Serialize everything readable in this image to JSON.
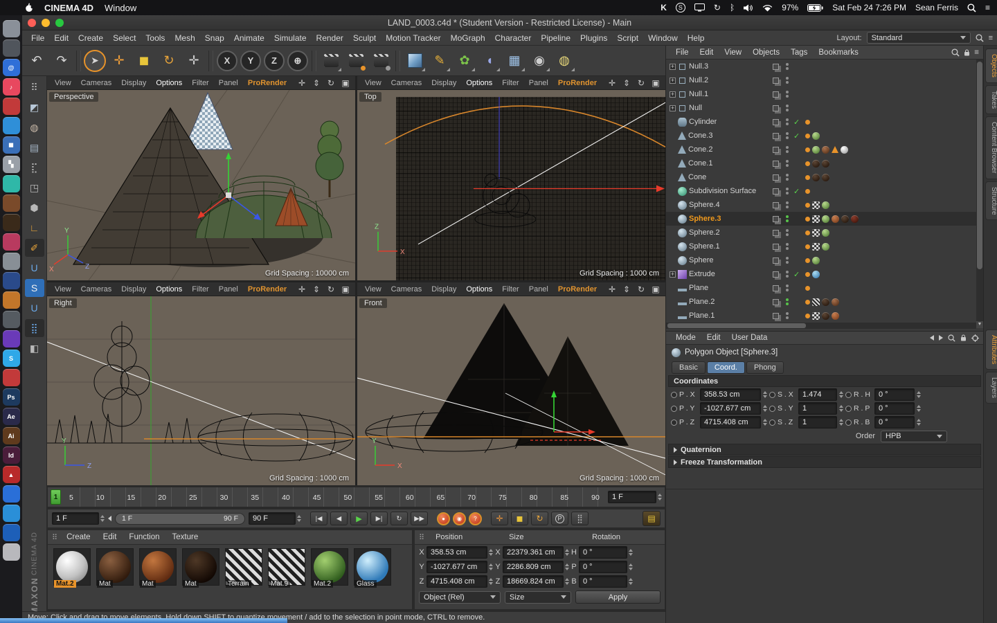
{
  "colors": {
    "accent": "#f09a1f",
    "selection_blue": "#5b7fa6",
    "viewport_bg": "#6b6257",
    "prorender_orange": "#e0932f"
  },
  "macos": {
    "app_name": "CINEMA 4D",
    "menus": [
      "Window"
    ],
    "status": {
      "battery": "97%",
      "datetime": "Sat Feb 24 7:26 PM",
      "user": "Sean Ferris"
    },
    "status_icon_names": [
      "keyboard-maestro",
      "skype",
      "display",
      "sync",
      "bluetooth",
      "volume",
      "wifi",
      "battery-charging",
      "spotlight-search",
      "notification-center"
    ]
  },
  "window_title": "LAND_0003.c4d * (Student Version - Restricted License) - Main",
  "app_menu": {
    "items": [
      "File",
      "Edit",
      "Create",
      "Select",
      "Tools",
      "Mesh",
      "Snap",
      "Animate",
      "Simulate",
      "Render",
      "Sculpt",
      "Motion Tracker",
      "MoGraph",
      "Character",
      "Pipeline",
      "Plugins",
      "Script",
      "Window",
      "Help"
    ],
    "layout_label": "Layout:",
    "layout_value": "Standard"
  },
  "icons": {
    "panel_handle": "⠿",
    "hamburger": "≡"
  },
  "toolbar": {
    "buttons": [
      {
        "name": "undo-icon",
        "glyph": "↶"
      },
      {
        "name": "redo-icon",
        "glyph": "↷"
      },
      {
        "cls": "sep"
      },
      {
        "name": "live-selection-icon",
        "glyph": "➤",
        "cls": "active-tool"
      },
      {
        "name": "move-tool-icon",
        "glyph": "✛",
        "fg": "#e89a3a"
      },
      {
        "name": "scale-tool-icon",
        "glyph": "◼",
        "fg": "#e8c53a"
      },
      {
        "name": "rotate-tool-icon",
        "glyph": "↻",
        "fg": "#e8a43a"
      },
      {
        "name": "last-tool-icon",
        "glyph": "✛",
        "fg": "#c9c9c9"
      },
      {
        "cls": "sep"
      },
      {
        "name": "lock-x-icon",
        "glyph": "X",
        "cls": "axis"
      },
      {
        "name": "lock-y-icon",
        "glyph": "Y",
        "cls": "axis"
      },
      {
        "name": "lock-z-icon",
        "glyph": "Z",
        "cls": "axis"
      },
      {
        "name": "coord-system-icon",
        "glyph": "⊕",
        "cls": "axis"
      },
      {
        "cls": "sep"
      },
      {
        "name": "render-view-icon",
        "cls": "clapper dd"
      },
      {
        "name": "render-picture-viewer-icon",
        "cls": "clapper c2 dd"
      },
      {
        "name": "render-settings-icon",
        "cls": "clapper c3 dd"
      },
      {
        "cls": "sep"
      },
      {
        "name": "add-primitive-cube-icon",
        "cls": "bigcube dd"
      },
      {
        "name": "add-spline-pen-icon",
        "glyph": "✎",
        "fg": "#e8b13a",
        "cls": "dd"
      },
      {
        "name": "mograph-icon",
        "glyph": "✿",
        "fg": "#7cc24a",
        "cls": "dd"
      },
      {
        "name": "simulate-deformer-icon",
        "glyph": "◖",
        "fg": "#9aa8e8",
        "cls": "dd"
      },
      {
        "name": "environment-floor-icon",
        "glyph": "▦",
        "fg": "#9fc3e8",
        "cls": "dd"
      },
      {
        "name": "camera-icon",
        "glyph": "◉",
        "fg": "#cfcfcf",
        "cls": "dd"
      },
      {
        "name": "light-icon",
        "glyph": "◍",
        "fg": "#e8d87a",
        "cls": "dd"
      }
    ]
  },
  "palette": {
    "icons": [
      {
        "name": "make-editable-icon",
        "glyph": "⠿",
        "fg": "#b8b8b8"
      },
      {
        "name": "model-mode-icon",
        "glyph": "◩",
        "fg": "#b8c8d8"
      },
      {
        "name": "texture-mode-icon",
        "glyph": "◍",
        "fg": "#c8b8a8"
      },
      {
        "name": "workplane-icon",
        "glyph": "▤",
        "fg": "#a8b8c8"
      },
      {
        "name": "points-mode-icon",
        "glyph": "⣏",
        "fg": "#b8b8b8"
      },
      {
        "name": "edges-mode-icon",
        "glyph": "◳",
        "fg": "#b8b8b8"
      },
      {
        "name": "polygons-mode-icon",
        "glyph": "⬢",
        "fg": "#b8b8b8"
      },
      {
        "name": "axis-mode-icon",
        "glyph": "∟",
        "fg": "#e8a43a"
      },
      {
        "name": "snap-pen-icon",
        "glyph": "✐",
        "fg": "#e8a43a",
        "bg": "#2c2c2c"
      },
      {
        "name": "magnet-snap-icon",
        "glyph": "U",
        "fg": "#6aa8e8"
      },
      {
        "name": "sculpt-icon",
        "glyph": "S",
        "fg": "#f0f0f0",
        "bg": "#2f6fb8"
      },
      {
        "name": "magnet-icon",
        "glyph": "U",
        "fg": "#6aa8e8"
      },
      {
        "name": "array-icon",
        "glyph": "⣿",
        "fg": "#6aa8e8",
        "bg": "#2c2c2c"
      },
      {
        "name": "lock-workplane-icon",
        "glyph": "◧",
        "fg": "#b8b8b8"
      }
    ]
  },
  "dock": {
    "icons": [
      {
        "name": "dock-finder-icon",
        "color": "#8a9099"
      },
      {
        "name": "dock-settings-icon",
        "color": "#50555c"
      },
      {
        "name": "dock-browser-icon",
        "color": "#2f6fd8",
        "glyph": "@"
      },
      {
        "name": "dock-music-icon",
        "color": "#e8485f",
        "glyph": "♪"
      },
      {
        "name": "dock-app-red-icon",
        "color": "#c23a3a"
      },
      {
        "name": "dock-app-blue-icon",
        "color": "#2f8fd8"
      },
      {
        "name": "dock-cinema4d-icon",
        "color": "#3a6fb8",
        "glyph": "◼"
      },
      {
        "name": "dock-checker-icon",
        "color": "#9aa0a8",
        "glyph": "▚"
      },
      {
        "name": "dock-chat-icon",
        "color": "#2fb8a8"
      },
      {
        "name": "dock-sphere-brown-icon",
        "color": "#7a4a2a"
      },
      {
        "name": "dock-sphere-dark-icon",
        "color": "#3a2a1a"
      },
      {
        "name": "dock-flower-icon",
        "color": "#b83a5f"
      },
      {
        "name": "dock-app-gray-icon",
        "color": "#888f96"
      },
      {
        "name": "dock-app-navy-icon",
        "color": "#2a4a8a"
      },
      {
        "name": "dock-pen-icon",
        "color": "#c2762a"
      },
      {
        "name": "dock-gear-icon",
        "color": "#555b61"
      },
      {
        "name": "dock-app-purple-icon",
        "color": "#6a3ab8"
      },
      {
        "name": "dock-skype-icon",
        "color": "#2fa8e8",
        "glyph": "S"
      },
      {
        "name": "dock-app-red2-icon",
        "color": "#c23a3a"
      },
      {
        "name": "dock-photoshop-icon",
        "color": "#1d3a5f",
        "glyph": "Ps"
      },
      {
        "name": "dock-aftereffects-icon",
        "color": "#2a2a4a",
        "glyph": "Ae"
      },
      {
        "name": "dock-illustrator-icon",
        "color": "#5f3a1d",
        "glyph": "Ai"
      },
      {
        "name": "dock-indesign-icon",
        "color": "#4a1d3a",
        "glyph": "Id"
      },
      {
        "name": "dock-acrobat-icon",
        "color": "#b82a2a",
        "glyph": "▲"
      },
      {
        "name": "dock-app-blue2-icon",
        "color": "#2a6fd8"
      },
      {
        "name": "dock-app-blue3-icon",
        "color": "#2a8fd8"
      },
      {
        "name": "dock-app-blue4-icon",
        "color": "#1d5fb8"
      },
      {
        "name": "dock-trash-icon",
        "color": "#b8b8bc"
      }
    ]
  },
  "maxon": {
    "brand": "MAXON",
    "product": "CINEMA 4D"
  },
  "viewport_menu": [
    {
      "label": "View"
    },
    {
      "label": "Cameras"
    },
    {
      "label": "Display"
    },
    {
      "label": "Options",
      "cls": "hl"
    },
    {
      "label": "Filter"
    },
    {
      "label": "Panel"
    },
    {
      "label": "ProRender",
      "cls": "pro"
    }
  ],
  "viewport_tools": [
    {
      "name": "move-view-icon",
      "glyph": "✛"
    },
    {
      "name": "zoom-view-icon",
      "glyph": "⇕"
    },
    {
      "name": "rotate-view-icon",
      "glyph": "↻"
    },
    {
      "name": "toggle-view-icon",
      "glyph": "▣"
    }
  ],
  "viewports": [
    {
      "name": "Perspective",
      "grid_label": "Grid Spacing : 10000 cm"
    },
    {
      "name": "Top",
      "grid_label": "Grid Spacing : 1000 cm"
    },
    {
      "name": "Right",
      "grid_label": "Grid Spacing : 1000 cm"
    },
    {
      "name": "Front",
      "grid_label": "Grid Spacing : 1000 cm"
    }
  ],
  "object_manager": {
    "menu": [
      "File",
      "Edit",
      "View",
      "Objects",
      "Tags",
      "Bookmarks"
    ],
    "objects": [
      {
        "name": "object-null3",
        "label": "Null.3",
        "icon": "null",
        "exp": "+",
        "chips": []
      },
      {
        "name": "object-null2",
        "label": "Null.2",
        "icon": "null",
        "exp": "+",
        "chips": []
      },
      {
        "name": "object-null1",
        "label": "Null.1",
        "icon": "null",
        "exp": "+",
        "chips": []
      },
      {
        "name": "object-null",
        "label": "Null",
        "icon": "null",
        "exp": "+",
        "chips": []
      },
      {
        "name": "object-cylinder",
        "label": "Cylinder",
        "icon": "cylinder",
        "check": "✓",
        "chips": [
          "odot"
        ]
      },
      {
        "name": "object-cone3",
        "label": "Cone.3",
        "icon": "cone",
        "check": "✓",
        "chips": [
          "odot",
          "green"
        ]
      },
      {
        "name": "object-cone2",
        "label": "Cone.2",
        "icon": "cone",
        "chips": [
          "odot",
          "green",
          "brown",
          "tri",
          "white"
        ]
      },
      {
        "name": "object-cone1",
        "label": "Cone.1",
        "icon": "cone",
        "chips": [
          "odot",
          "dark",
          "dark"
        ]
      },
      {
        "name": "object-cone",
        "label": "Cone",
        "icon": "cone",
        "chips": [
          "odot",
          "dark",
          "dark"
        ]
      },
      {
        "name": "object-subdivision-surface",
        "label": "Subdivision Surface",
        "icon": "sds",
        "check": "✓",
        "chips": [
          "odot"
        ]
      },
      {
        "name": "object-sphere4",
        "label": "Sphere.4",
        "icon": "sphere",
        "chips": [
          "odot",
          "checker",
          "green"
        ]
      },
      {
        "name": "object-sphere3",
        "label": "Sphere.3",
        "icon": "sphere",
        "sel": "selected",
        "dots": "green",
        "chips": [
          "odot",
          "checker",
          "green",
          "rust",
          "dark",
          "darkred"
        ]
      },
      {
        "name": "object-sphere2",
        "label": "Sphere.2",
        "icon": "sphere",
        "chips": [
          "odot",
          "checker",
          "green"
        ]
      },
      {
        "name": "object-sphere1",
        "label": "Sphere.1",
        "icon": "sphere",
        "chips": [
          "odot",
          "checker",
          "green"
        ]
      },
      {
        "name": "object-sphere",
        "label": "Sphere",
        "icon": "sphere",
        "chips": [
          "odot",
          "green"
        ]
      },
      {
        "name": "object-extrude",
        "label": "Extrude",
        "icon": "extrude",
        "exp": "+",
        "check": "✓",
        "chips": [
          "odot",
          "blue"
        ]
      },
      {
        "name": "object-plane",
        "label": "Plane",
        "icon": "plane",
        "chips": [
          "odot"
        ]
      },
      {
        "name": "object-plane2",
        "label": "Plane.2",
        "icon": "plane",
        "dots": "green",
        "chips": [
          "odot",
          "stripes",
          "dark",
          "brown"
        ]
      },
      {
        "name": "object-plane1",
        "label": "Plane.1",
        "icon": "plane",
        "chips": [
          "odot",
          "checker",
          "dark",
          "rust"
        ]
      }
    ],
    "side_tabs": [
      {
        "label": "Objects",
        "cls": "active"
      },
      {
        "label": "Takes"
      },
      {
        "label": "Content Browser"
      },
      {
        "label": "Structure"
      }
    ]
  },
  "attributes": {
    "menu": [
      "Mode",
      "Edit",
      "User Data"
    ],
    "object_title": "Polygon Object [Sphere.3]",
    "tabs": [
      {
        "label": "Basic"
      },
      {
        "label": "Coord.",
        "cls": "active"
      },
      {
        "label": "Phong"
      }
    ],
    "section_title": "Coordinates",
    "rows": [
      {
        "pl": "P . X",
        "pv": "358.53 cm",
        "sl": "S . X",
        "sv": "1.474",
        "rl": "R . H",
        "rv": "0 °"
      },
      {
        "pl": "P . Y",
        "pv": "-1027.677 cm",
        "sl": "S . Y",
        "sv": "1",
        "rl": "R . P",
        "rv": "0 °"
      },
      {
        "pl": "P . Z",
        "pv": "4715.408 cm",
        "sl": "S . Z",
        "sv": "1",
        "rl": "R . B",
        "rv": "0 °"
      }
    ],
    "order_label": "Order",
    "order_value": "HPB",
    "sections": [
      "Quaternion",
      "Freeze Transformation"
    ],
    "side_tabs": [
      {
        "label": "Attributes",
        "cls": "active"
      },
      {
        "label": "Layers"
      }
    ]
  },
  "timeline": {
    "marker": "1",
    "ticks": [
      "5",
      "10",
      "15",
      "20",
      "25",
      "30",
      "35",
      "40",
      "45",
      "50",
      "55",
      "60",
      "65",
      "70",
      "75",
      "80",
      "85",
      "90"
    ],
    "ruler_frame": "1 F"
  },
  "transport": {
    "current": "1 F",
    "range_start": "1 F",
    "range_end": "90 F",
    "end": "90 F",
    "nav": [
      {
        "name": "goto-start-button",
        "glyph": "|◀"
      },
      {
        "name": "prev-key-button",
        "glyph": "◀"
      },
      {
        "name": "play-button",
        "glyph": "▶",
        "cls": "play"
      },
      {
        "name": "next-key-button",
        "glyph": "▶|"
      },
      {
        "name": "loop-button",
        "glyph": "↻"
      },
      {
        "name": "goto-end-button",
        "glyph": "▶▶"
      }
    ],
    "rec": [
      {
        "name": "record-keyframe-button",
        "glyph": "●"
      },
      {
        "name": "autokey-button",
        "glyph": "◉"
      },
      {
        "name": "keyframe-selection-button",
        "glyph": "?"
      }
    ],
    "keys": [
      {
        "name": "key-position-icon",
        "glyph": "✛",
        "fg": "#e8933a"
      },
      {
        "name": "key-scale-icon",
        "glyph": "◼",
        "fg": "#e8c53a"
      },
      {
        "name": "key-rotation-icon",
        "glyph": "↻",
        "fg": "#e8a43a"
      },
      {
        "name": "key-parameter-icon",
        "glyph": "P",
        "fg": "#dddddd",
        "cls": "pcirc"
      },
      {
        "name": "key-pla-icon",
        "glyph": "⣿",
        "fg": "#bbbbbb"
      }
    ]
  },
  "materials": {
    "menu": [
      "Create",
      "Edit",
      "Function",
      "Texture"
    ],
    "items": [
      {
        "name": "material-mat2-white",
        "label": "Mat.2",
        "cls": "m-white",
        "sel": "selected"
      },
      {
        "name": "material-mat-darkbrown",
        "label": "Mat",
        "cls": "m-darkbrown"
      },
      {
        "name": "material-mat-rust",
        "label": "Mat",
        "cls": "m-rust"
      },
      {
        "name": "material-mat-dark",
        "label": "Mat",
        "cls": "m-dark"
      },
      {
        "name": "material-terrain",
        "label": "Terrain",
        "cls": "m-stripes"
      },
      {
        "name": "material-mat9",
        "label": "Mat.9",
        "cls": "m-stripes"
      },
      {
        "name": "material-mat2-green",
        "label": "Mat.2",
        "cls": "m-green"
      },
      {
        "name": "material-glass",
        "label": "Glass",
        "cls": "m-blue"
      }
    ]
  },
  "coord_manager": {
    "headers": [
      "Position",
      "Size",
      "Rotation"
    ],
    "rows": [
      {
        "a": "X",
        "p": "358.53 cm",
        "s": "22379.361 cm",
        "ra": "H",
        "r": "0 °"
      },
      {
        "a": "Y",
        "p": "-1027.677 cm",
        "s": "2286.809 cm",
        "ra": "P",
        "r": "0 °"
      },
      {
        "a": "Z",
        "p": "4715.408 cm",
        "s": "18669.824 cm",
        "ra": "B",
        "r": "0 °"
      }
    ],
    "object_mode": "Object (Rel)",
    "size_mode": "Size",
    "apply": "Apply"
  },
  "status_bar": {
    "text": "Move: Click and drag to move elements. Hold down SHIFT to quantize movement / add to the selection in point mode, CTRL to remove."
  }
}
